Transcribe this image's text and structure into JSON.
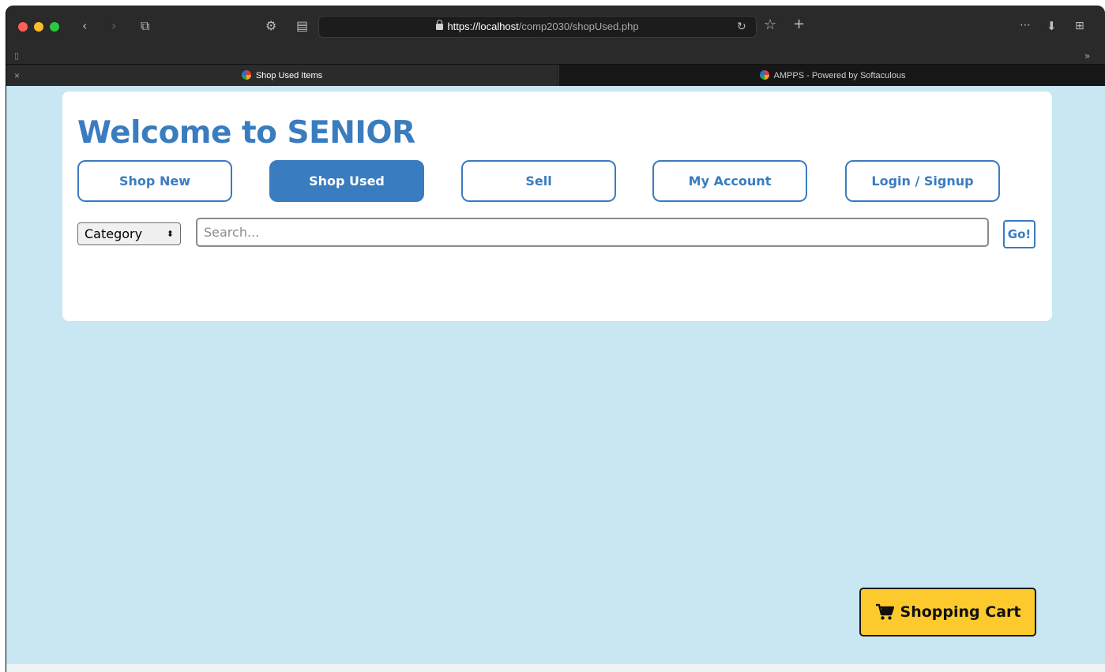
{
  "browser": {
    "url_prefix": "https://",
    "url_host": "localhost",
    "url_path": "/comp2030/shopUsed.php",
    "tabs": [
      {
        "label": "Shop Used Items",
        "active": true
      },
      {
        "label": "AMPPS - Powered by Softaculous",
        "active": false
      }
    ]
  },
  "page": {
    "title": "Welcome to SENIOR",
    "nav": [
      {
        "label": "Shop New"
      },
      {
        "label": "Shop Used"
      },
      {
        "label": "Sell"
      },
      {
        "label": "My Account"
      },
      {
        "label": "Login / Signup"
      }
    ],
    "category": {
      "selected": "Category"
    },
    "search": {
      "placeholder": "Search...",
      "value": ""
    },
    "go_label": "Go!",
    "cart_label": "Shopping Cart"
  },
  "colors": {
    "accent": "#3a7cc0",
    "page_background": "#c8e7f2",
    "cart_button": "#fdca2e"
  },
  "icons": {
    "cart": "shopping-cart-icon"
  }
}
